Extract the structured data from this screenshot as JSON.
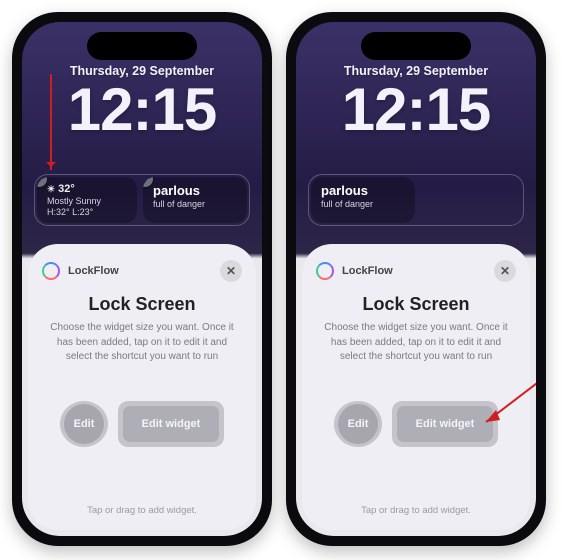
{
  "lock": {
    "date": "Thursday, 29 September",
    "time": "12:15"
  },
  "widgets": {
    "weather": {
      "temp_line": "32°",
      "condition": "Mostly Sunny",
      "hi_lo": "H:32° L:23°"
    },
    "word": {
      "term": "parlous",
      "definition": "full of danger"
    }
  },
  "sheet": {
    "app_name": "LockFlow",
    "title": "Lock Screen",
    "description": "Choose the widget size you want. Once it has been added, tap on it to edit it and select the shortcut you want to run",
    "small_label": "Edit",
    "wide_label": "Edit widget",
    "hint": "Tap or drag to add widget."
  }
}
